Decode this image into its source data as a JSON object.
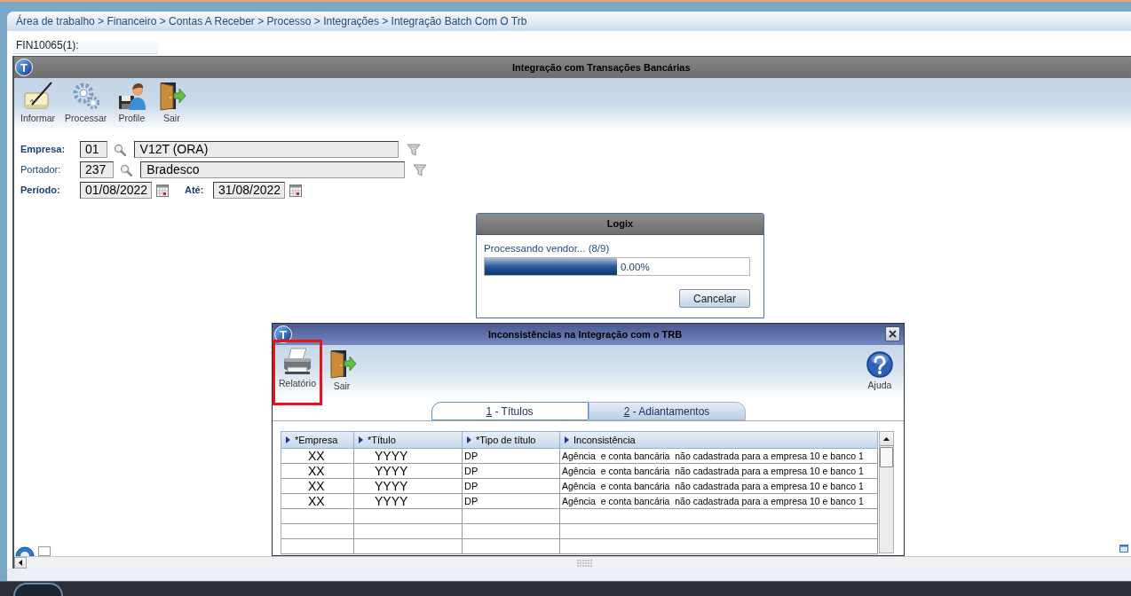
{
  "breadcrumb": "Área de trabalho > Financeiro > Contas A Receber > Processo > Integrações > Integração Batch Com O Trb",
  "program_tab": "FIN10065(1):",
  "main_window": {
    "logo": "T",
    "title": "Integração com Transações Bancárias",
    "toolbar": [
      {
        "kind": "edit",
        "label": "Informar"
      },
      {
        "kind": "process",
        "label": "Processar"
      },
      {
        "kind": "profile",
        "label": "Profile"
      },
      {
        "kind": "exit",
        "label": "Sair"
      }
    ],
    "fields": [
      {
        "label": "Empresa:",
        "required": true,
        "code": "01",
        "description": "V12T (ORA)"
      },
      {
        "label": "Portador:",
        "required": false,
        "code": "237",
        "description": "Bradesco"
      }
    ],
    "period": {
      "label": "Período:",
      "required": true,
      "from": "01/08/2022",
      "to_label": "Até:",
      "to": "31/08/2022"
    }
  },
  "progress_dialog": {
    "title": "Logix",
    "message": "Processando vendor... (8/9)",
    "level": 0.5,
    "percent": "0.00%",
    "button": "Cancelar"
  },
  "inconsistencies_dialog": {
    "logo": "T",
    "title": "Inconsistências na Integração com o TRB",
    "toolbar": [
      {
        "kind": "report",
        "label": "Relatório",
        "highlighted": true
      },
      {
        "kind": "exit",
        "label": "Sair",
        "highlighted": false
      }
    ],
    "help_button": {
      "kind": "help",
      "label": "Ajuda"
    },
    "tabs": [
      {
        "label": "1 - Títulos",
        "selected": true
      },
      {
        "label": "2 - Adiantamentos",
        "selected": false
      }
    ],
    "table": {
      "columns": [
        "*Empresa",
        "*Título",
        "*Tipo de título",
        "Inconsistência"
      ],
      "rows": [
        [
          "XX",
          "YYYY",
          "DP",
          "Agência  e conta bancária  não cadastrada para a empresa 10 e banco 1"
        ],
        [
          "XX",
          "YYYY",
          "DP",
          "Agência  e conta bancária  não cadastrada para a empresa 10 e banco 1"
        ],
        [
          "XX",
          "YYYY",
          "DP",
          "Agência  e conta bancária  não cadastrada para a empresa 10 e banco 1"
        ],
        [
          "XX",
          "YYYY",
          "DP",
          "Agência  e conta bancária  não cadastrada para a empresa 10 e banco 1"
        ]
      ]
    }
  }
}
